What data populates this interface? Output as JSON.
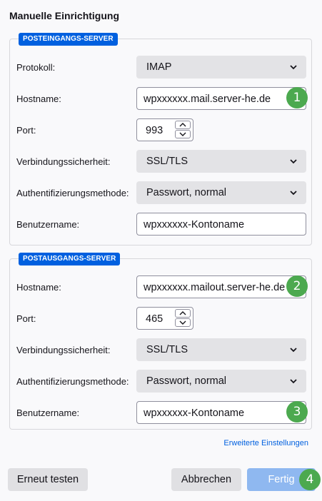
{
  "title": "Manuelle Einrichtigung",
  "incoming": {
    "legend": "POSTEINGANGS-SERVER",
    "protocol_label": "Protokoll:",
    "protocol_value": "IMAP",
    "hostname_label": "Hostname:",
    "hostname_value": "wpxxxxxx.mail.server-he.de",
    "port_label": "Port:",
    "port_value": "993",
    "security_label": "Verbindungssicherheit:",
    "security_value": "SSL/TLS",
    "auth_label": "Authentifizierungsmethode:",
    "auth_value": "Passwort, normal",
    "username_label": "Benutzername:",
    "username_value": "wpxxxxxx-Kontoname"
  },
  "outgoing": {
    "legend": "POSTAUSGANGS-SERVER",
    "hostname_label": "Hostname:",
    "hostname_value": "wpxxxxxx.mailout.server-he.de",
    "port_label": "Port:",
    "port_value": "465",
    "security_label": "Verbindungssicherheit:",
    "security_value": "SSL/TLS",
    "auth_label": "Authentifizierungsmethode:",
    "auth_value": "Passwort, normal",
    "username_label": "Benutzername:",
    "username_value": "wpxxxxxx-Kontoname"
  },
  "badges": [
    "1",
    "2",
    "3",
    "4"
  ],
  "advanced_link": "Erweiterte Einstellungen",
  "buttons": {
    "retest": "Erneut testen",
    "cancel": "Abbrechen",
    "done": "Fertig"
  },
  "colors": {
    "accent": "#0060df",
    "badge": "#4ca94f",
    "done_button": "#8fb8f0"
  },
  "icons": {
    "select_arrow": "chevron-down-icon",
    "spin_up": "chevron-up-icon",
    "spin_down": "chevron-down-icon"
  }
}
